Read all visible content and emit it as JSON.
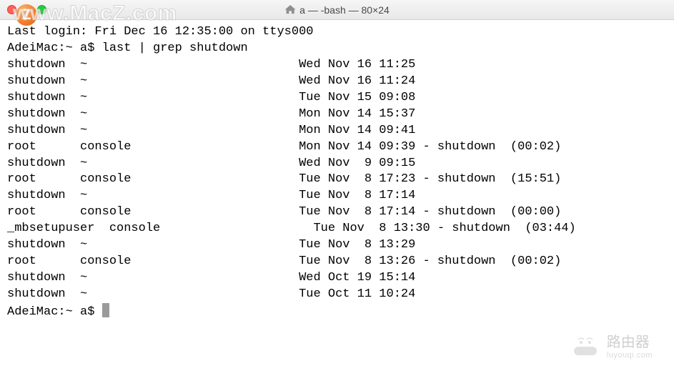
{
  "window": {
    "title": "a — -bash — 80×24"
  },
  "watermarks": {
    "top": "www.MacZ.com",
    "logo": "Z",
    "br_text": "路由器",
    "br_sub": "luyouqi.com"
  },
  "terminal": {
    "last_login": "Last login: Fri Dec 16 12:35:00 on ttys000",
    "prompt_line": "AdeiMac:~ a$ last | grep shutdown",
    "rows": [
      {
        "user": "shutdown",
        "tty": "~",
        "when": "Wed Nov 16 11:25",
        "extra": ""
      },
      {
        "user": "shutdown",
        "tty": "~",
        "when": "Wed Nov 16 11:24",
        "extra": ""
      },
      {
        "user": "shutdown",
        "tty": "~",
        "when": "Tue Nov 15 09:08",
        "extra": ""
      },
      {
        "user": "shutdown",
        "tty": "~",
        "when": "Mon Nov 14 15:37",
        "extra": ""
      },
      {
        "user": "shutdown",
        "tty": "~",
        "when": "Mon Nov 14 09:41",
        "extra": ""
      },
      {
        "user": "root",
        "tty": "console",
        "when": "Mon Nov 14 09:39",
        "extra": " - shutdown  (00:02)"
      },
      {
        "user": "shutdown",
        "tty": "~",
        "when": "Wed Nov  9 09:15",
        "extra": ""
      },
      {
        "user": "root",
        "tty": "console",
        "when": "Tue Nov  8 17:23",
        "extra": " - shutdown  (15:51)"
      },
      {
        "user": "shutdown",
        "tty": "~",
        "when": "Tue Nov  8 17:14",
        "extra": ""
      },
      {
        "user": "root",
        "tty": "console",
        "when": "Tue Nov  8 17:14",
        "extra": " - shutdown  (00:00)"
      },
      {
        "user": "_mbsetupuser",
        "tty": "console",
        "when": "Tue Nov  8 13:30",
        "extra": " - shutdown  (03:44)",
        "special": true
      },
      {
        "user": "shutdown",
        "tty": "~",
        "when": "Tue Nov  8 13:29",
        "extra": ""
      },
      {
        "user": "root",
        "tty": "console",
        "when": "Tue Nov  8 13:26",
        "extra": " - shutdown  (00:02)"
      },
      {
        "user": "shutdown",
        "tty": "~",
        "when": "Wed Oct 19 15:14",
        "extra": ""
      },
      {
        "user": "shutdown",
        "tty": "~",
        "when": "Tue Oct 11 10:24",
        "extra": ""
      }
    ],
    "prompt_end": "AdeiMac:~ a$ "
  }
}
